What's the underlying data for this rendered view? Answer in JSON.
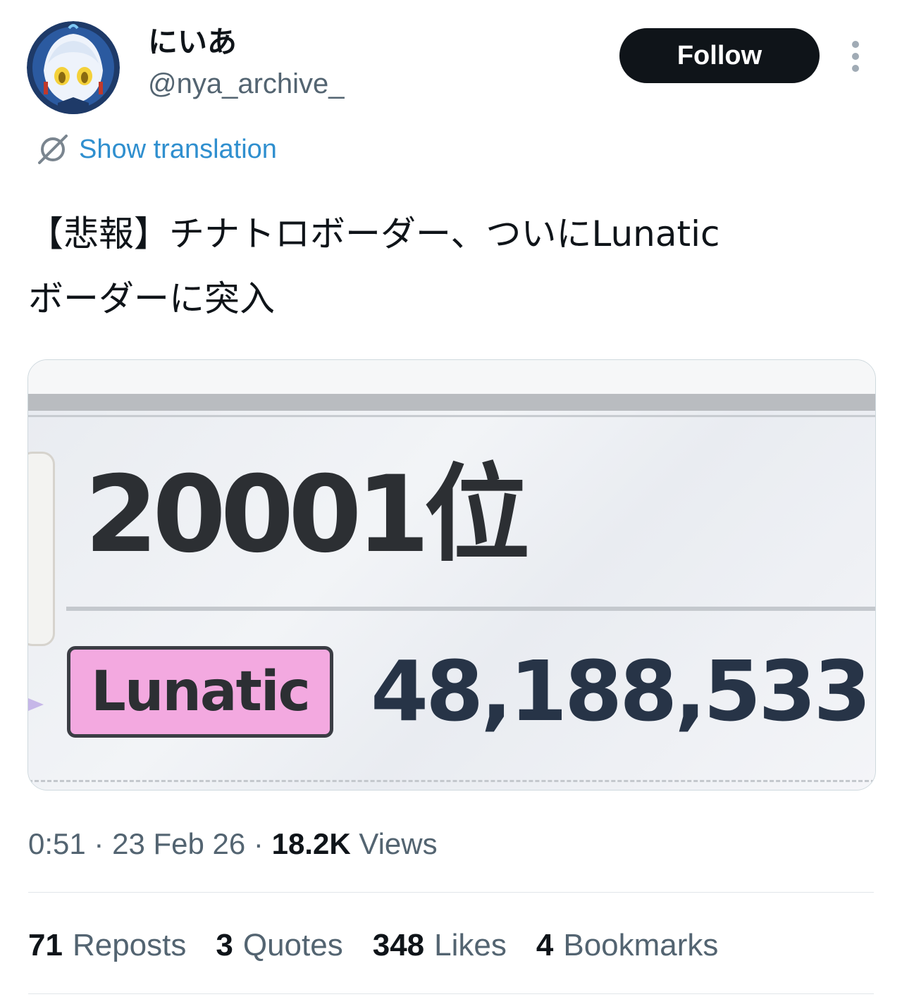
{
  "author": {
    "display_name": "にいあ",
    "handle": "@nya_archive_",
    "avatar_icon": "anime-avatar"
  },
  "actions": {
    "follow_label": "Follow",
    "more_icon": "more-vertical-icon"
  },
  "translation": {
    "label": "Show translation",
    "icon": "globe-translate-icon"
  },
  "tweet": {
    "text_line1": "【悲報】チナトロボーダー、ついにLunatic",
    "text_line2": "ボーダーに突入"
  },
  "media": {
    "rank": "20001位",
    "difficulty_badge": "Lunatic",
    "score": "48,188,533",
    "badge_color": "#f3a9e0"
  },
  "meta": {
    "time": "0:51",
    "date": "23 Feb 26",
    "views_count": "18.2K",
    "views_label": "Views",
    "separator": "·"
  },
  "stats": {
    "reposts_count": "71",
    "reposts_label": "Reposts",
    "quotes_count": "3",
    "quotes_label": "Quotes",
    "likes_count": "348",
    "likes_label": "Likes",
    "bookmarks_count": "4",
    "bookmarks_label": "Bookmarks"
  }
}
